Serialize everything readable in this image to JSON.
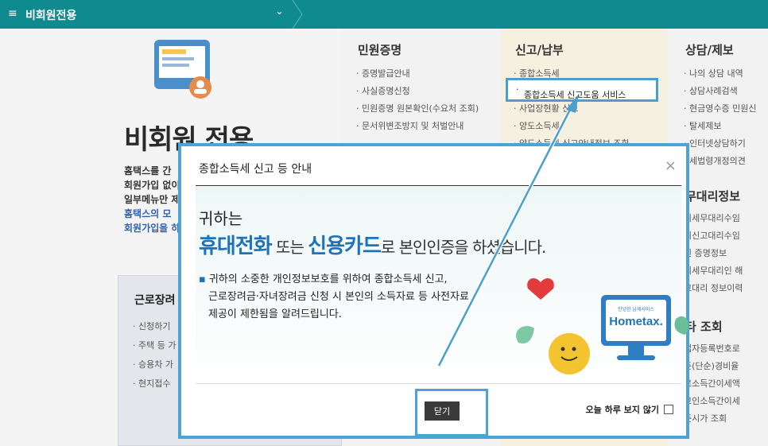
{
  "topbar": {
    "menu_icon": "≡",
    "title": "비회원전용",
    "chevron": "⌄"
  },
  "left": {
    "big_title": "비회원 전용",
    "lines": [
      "홈택스를 간",
      "회원가입 없이",
      "일부메뉴만 제"
    ],
    "blue_lines": [
      "홈택스의 모",
      "회원가입을 하"
    ],
    "card": {
      "title": "근로장려",
      "items": [
        "신청하기",
        "주택 등 가",
        "승용차 가",
        "현지접수"
      ]
    }
  },
  "col1": {
    "title": "민원증명",
    "items": [
      "증명발급안내",
      "사실증명신청",
      "민원증명 원본확인(수요처 조회)",
      "문서위변조방지 및 처벌안내"
    ]
  },
  "col2": {
    "title": "신고/납부",
    "items": [
      "종합소득세",
      "종합소득세 신고도움 서비스",
      "사업장현황 신고",
      "양도소득세",
      "양도소득세 신고안내정보 조회"
    ]
  },
  "col3": {
    "title": "상담/제보",
    "items": [
      "나의 상담 내역",
      "상담사례검색",
      "현금영수증 민원신",
      "탈세제보",
      "인터넷상담하기",
      "세법령개정의견"
    ],
    "sub2": "무대리정보",
    "items2": [
      "의세무대리수임",
      "의신고대리수임",
      "된 증명정보",
      "의세무대리인 해",
      "고대리 정보이력"
    ],
    "sub3": "타 조회",
    "items3": [
      "업자등록번호로",
      "준(단순)경비율",
      "로소득간이세액",
      "교인소득간이세",
      "준시가 조회"
    ]
  },
  "highlight_menu": "종합소득세 신고도움 서비스",
  "modal": {
    "title": "종합소득세 신고 등 안내",
    "close_icon": "×",
    "greet_line1": "귀하는",
    "greet_hl1": "휴대전화",
    "greet_mid": " 또는 ",
    "greet_hl2": "신용카드",
    "greet_rest": "로 본인인증을 하셨습니다.",
    "notice_lines": [
      "귀하의 소중한 개인정보보호를 위하여 종합소득세 신고,",
      "근로장려금·자녀장려금 신청 시 본인의 소득자료 등 사전자료",
      "제공이 제한됨을 알려드립니다."
    ],
    "bullet": "▪",
    "logo_small": "안녕한 납세서비스",
    "logo_text": "Hometax.",
    "close_button": "닫기",
    "no_show_label": "오늘 하루 보지 않기"
  },
  "colors": {
    "topbar": "#0f8a8e",
    "highlight": "#4ea3d4",
    "brand_blue": "#1e73b8"
  }
}
